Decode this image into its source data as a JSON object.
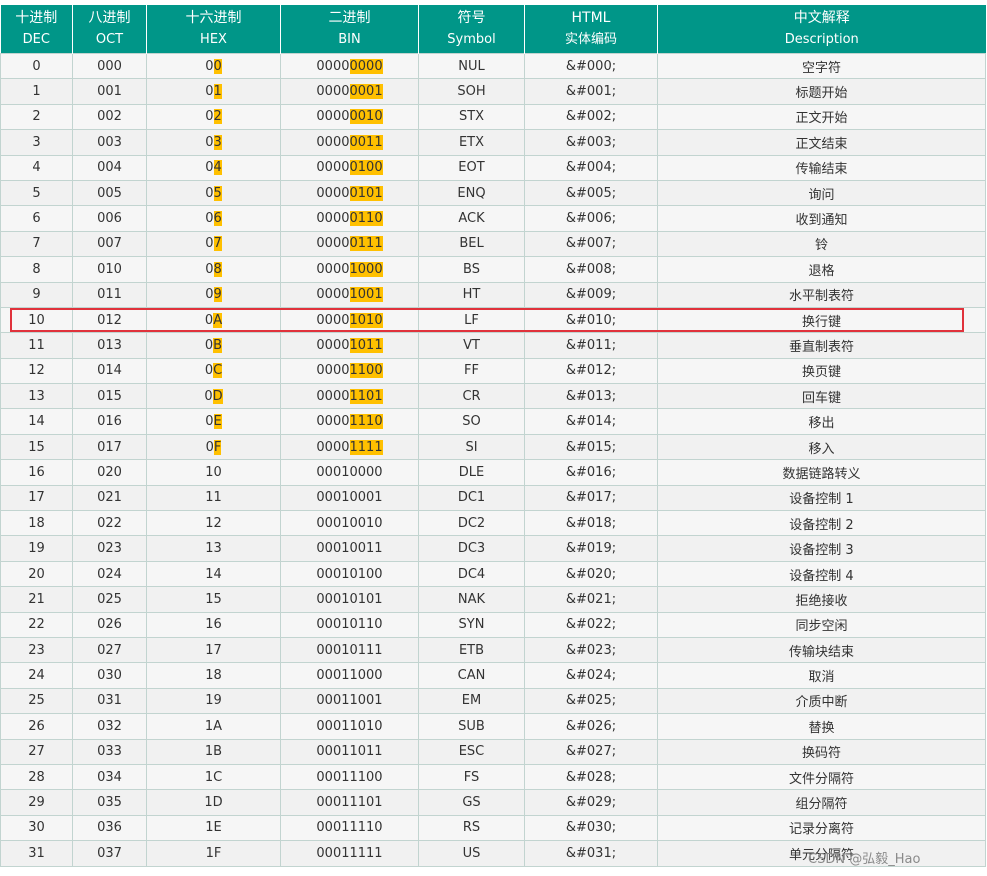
{
  "headers": [
    {
      "zh": "十进制",
      "en": "DEC"
    },
    {
      "zh": "八进制",
      "en": "OCT"
    },
    {
      "zh": "十六进制",
      "en": "HEX"
    },
    {
      "zh": "二进制",
      "en": "BIN"
    },
    {
      "zh": "符号",
      "en": "Symbol"
    },
    {
      "zh": "HTML",
      "en": "实体编码"
    },
    {
      "zh": "中文解释",
      "en": "Description"
    }
  ],
  "rows": [
    {
      "dec": "0",
      "oct": "000",
      "hex": "00",
      "bin": "00000000",
      "sym": "NUL",
      "html": "&#000;",
      "desc": "空字符"
    },
    {
      "dec": "1",
      "oct": "001",
      "hex": "01",
      "bin": "00000001",
      "sym": "SOH",
      "html": "&#001;",
      "desc": "标题开始"
    },
    {
      "dec": "2",
      "oct": "002",
      "hex": "02",
      "bin": "00000010",
      "sym": "STX",
      "html": "&#002;",
      "desc": "正文开始"
    },
    {
      "dec": "3",
      "oct": "003",
      "hex": "03",
      "bin": "00000011",
      "sym": "ETX",
      "html": "&#003;",
      "desc": "正文结束"
    },
    {
      "dec": "4",
      "oct": "004",
      "hex": "04",
      "bin": "00000100",
      "sym": "EOT",
      "html": "&#004;",
      "desc": "传输结束"
    },
    {
      "dec": "5",
      "oct": "005",
      "hex": "05",
      "bin": "00000101",
      "sym": "ENQ",
      "html": "&#005;",
      "desc": "询问"
    },
    {
      "dec": "6",
      "oct": "006",
      "hex": "06",
      "bin": "00000110",
      "sym": "ACK",
      "html": "&#006;",
      "desc": "收到通知"
    },
    {
      "dec": "7",
      "oct": "007",
      "hex": "07",
      "bin": "00000111",
      "sym": "BEL",
      "html": "&#007;",
      "desc": "铃"
    },
    {
      "dec": "8",
      "oct": "010",
      "hex": "08",
      "bin": "00001000",
      "sym": "BS",
      "html": "&#008;",
      "desc": "退格"
    },
    {
      "dec": "9",
      "oct": "011",
      "hex": "09",
      "bin": "00001001",
      "sym": "HT",
      "html": "&#009;",
      "desc": "水平制表符"
    },
    {
      "dec": "10",
      "oct": "012",
      "hex": "0A",
      "bin": "00001010",
      "sym": "LF",
      "html": "&#010;",
      "desc": "换行键"
    },
    {
      "dec": "11",
      "oct": "013",
      "hex": "0B",
      "bin": "00001011",
      "sym": "VT",
      "html": "&#011;",
      "desc": "垂直制表符"
    },
    {
      "dec": "12",
      "oct": "014",
      "hex": "0C",
      "bin": "00001100",
      "sym": "FF",
      "html": "&#012;",
      "desc": "换页键"
    },
    {
      "dec": "13",
      "oct": "015",
      "hex": "0D",
      "bin": "00001101",
      "sym": "CR",
      "html": "&#013;",
      "desc": "回车键"
    },
    {
      "dec": "14",
      "oct": "016",
      "hex": "0E",
      "bin": "00001110",
      "sym": "SO",
      "html": "&#014;",
      "desc": "移出"
    },
    {
      "dec": "15",
      "oct": "017",
      "hex": "0F",
      "bin": "00001111",
      "sym": "SI",
      "html": "&#015;",
      "desc": "移入"
    },
    {
      "dec": "16",
      "oct": "020",
      "hex": "10",
      "bin": "00010000",
      "sym": "DLE",
      "html": "&#016;",
      "desc": "数据链路转义"
    },
    {
      "dec": "17",
      "oct": "021",
      "hex": "11",
      "bin": "00010001",
      "sym": "DC1",
      "html": "&#017;",
      "desc": "设备控制 1"
    },
    {
      "dec": "18",
      "oct": "022",
      "hex": "12",
      "bin": "00010010",
      "sym": "DC2",
      "html": "&#018;",
      "desc": "设备控制 2"
    },
    {
      "dec": "19",
      "oct": "023",
      "hex": "13",
      "bin": "00010011",
      "sym": "DC3",
      "html": "&#019;",
      "desc": "设备控制 3"
    },
    {
      "dec": "20",
      "oct": "024",
      "hex": "14",
      "bin": "00010100",
      "sym": "DC4",
      "html": "&#020;",
      "desc": "设备控制 4"
    },
    {
      "dec": "21",
      "oct": "025",
      "hex": "15",
      "bin": "00010101",
      "sym": "NAK",
      "html": "&#021;",
      "desc": "拒绝接收"
    },
    {
      "dec": "22",
      "oct": "026",
      "hex": "16",
      "bin": "00010110",
      "sym": "SYN",
      "html": "&#022;",
      "desc": "同步空闲"
    },
    {
      "dec": "23",
      "oct": "027",
      "hex": "17",
      "bin": "00010111",
      "sym": "ETB",
      "html": "&#023;",
      "desc": "传输块结束"
    },
    {
      "dec": "24",
      "oct": "030",
      "hex": "18",
      "bin": "00011000",
      "sym": "CAN",
      "html": "&#024;",
      "desc": "取消"
    },
    {
      "dec": "25",
      "oct": "031",
      "hex": "19",
      "bin": "00011001",
      "sym": "EM",
      "html": "&#025;",
      "desc": "介质中断"
    },
    {
      "dec": "26",
      "oct": "032",
      "hex": "1A",
      "bin": "00011010",
      "sym": "SUB",
      "html": "&#026;",
      "desc": "替换"
    },
    {
      "dec": "27",
      "oct": "033",
      "hex": "1B",
      "bin": "00011011",
      "sym": "ESC",
      "html": "&#027;",
      "desc": "换码符"
    },
    {
      "dec": "28",
      "oct": "034",
      "hex": "1C",
      "bin": "00011100",
      "sym": "FS",
      "html": "&#028;",
      "desc": "文件分隔符"
    },
    {
      "dec": "29",
      "oct": "035",
      "hex": "1D",
      "bin": "00011101",
      "sym": "GS",
      "html": "&#029;",
      "desc": "组分隔符"
    },
    {
      "dec": "30",
      "oct": "036",
      "hex": "1E",
      "bin": "00011110",
      "sym": "RS",
      "html": "&#030;",
      "desc": "记录分离符"
    },
    {
      "dec": "31",
      "oct": "037",
      "hex": "1F",
      "bin": "00011111",
      "sym": "US",
      "html": "&#031;",
      "desc": "单元分隔符"
    }
  ],
  "highlight_rows_upto_dec": 15,
  "boxed_row_dec": "10",
  "colors": {
    "header_bg": "#009688",
    "highlight": "#ffc000",
    "box": "#e0323c"
  },
  "watermark": "CSDN @弘毅_Hao"
}
